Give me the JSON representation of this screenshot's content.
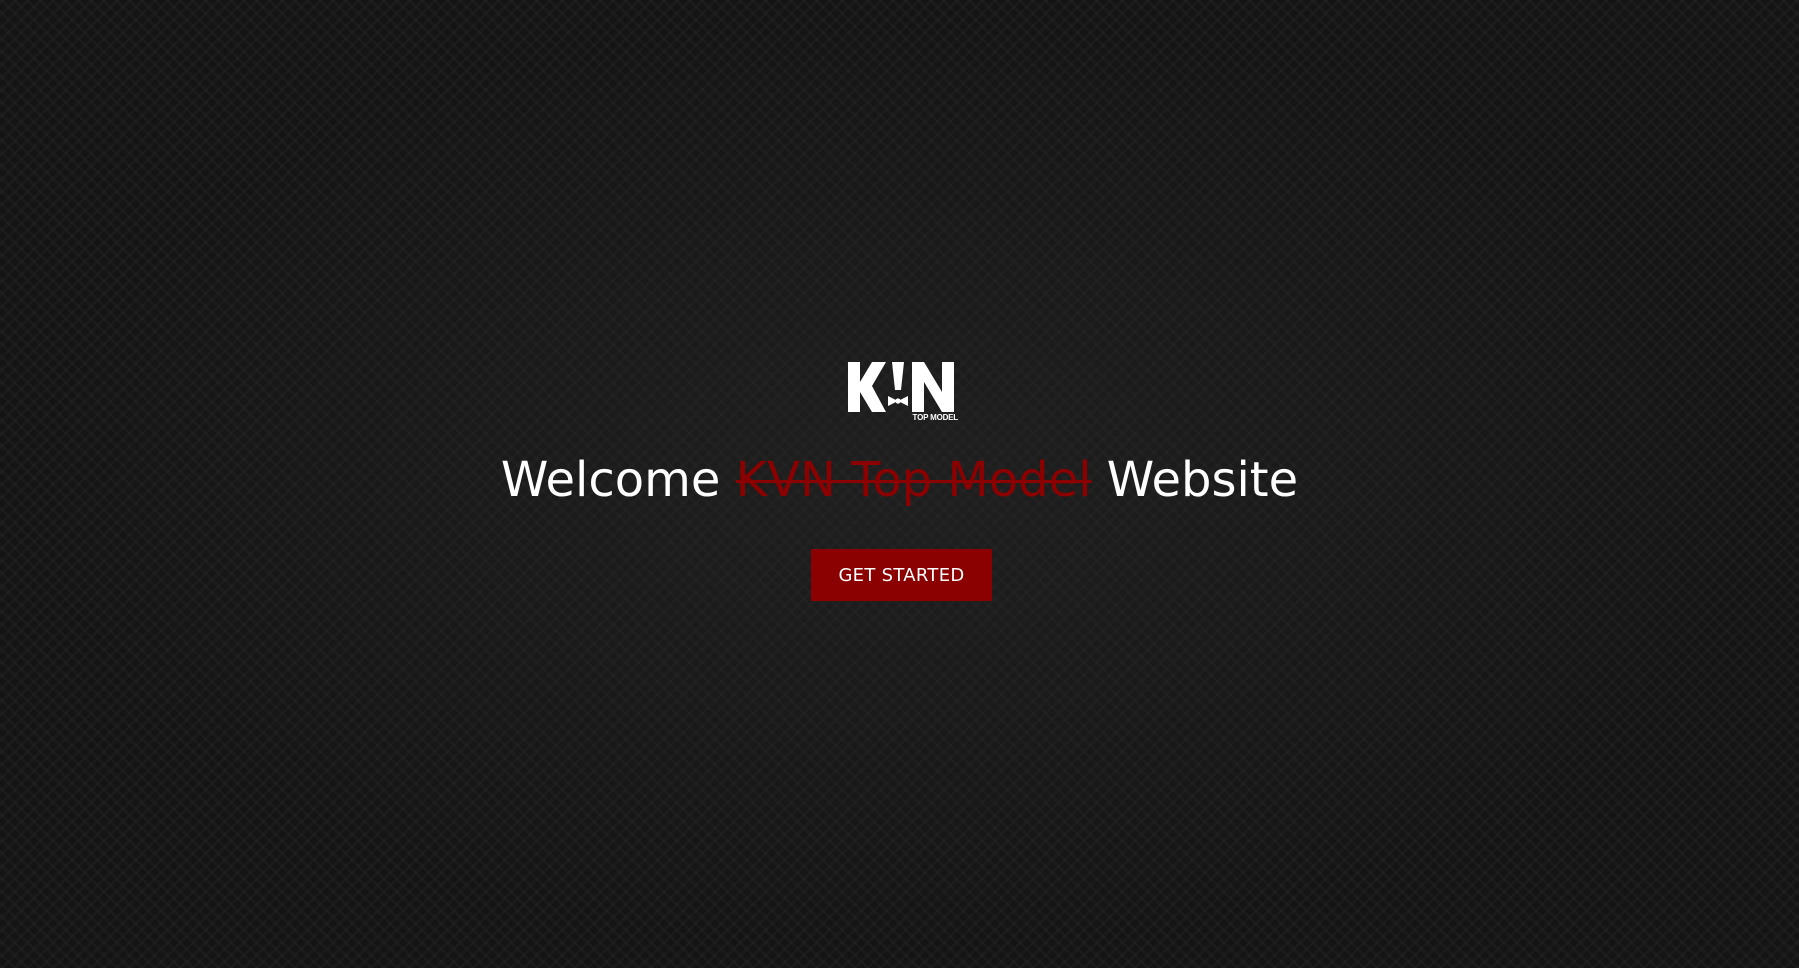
{
  "brand": {
    "logo_text": "KVN",
    "logo_subtitle": "TOP MODEL"
  },
  "hero": {
    "headline_prefix": "Welcome",
    "headline_strikethrough": "KVN Top Model",
    "headline_suffix": "Website",
    "cta_label": "GET STARTED"
  },
  "colors": {
    "background": "#141414",
    "accent": "#8b0000",
    "text": "#ffffff"
  }
}
